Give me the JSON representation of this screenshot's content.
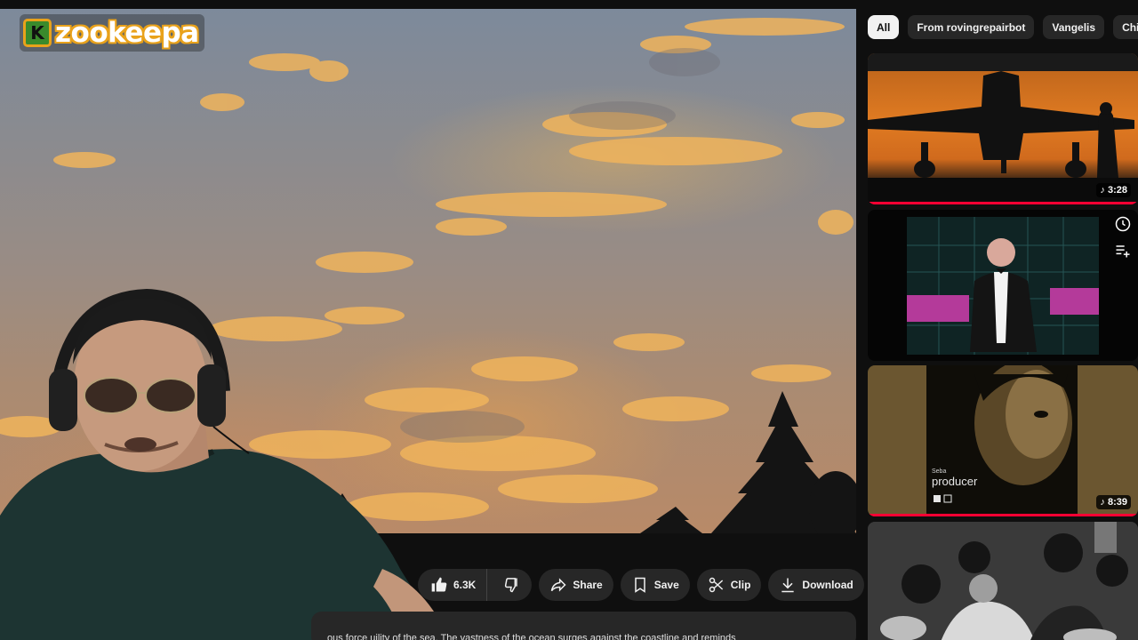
{
  "logo": {
    "icon_letter": "K",
    "text": "zookeepa",
    "icon_name": "kick-logo-icon",
    "accent": "#e9a21b",
    "brand_green": "#3a8a2c"
  },
  "actions": {
    "like_count": "6.3K",
    "share_label": "Share",
    "save_label": "Save",
    "clip_label": "Clip",
    "download_label": "Download",
    "icons": [
      "thumbs-up-icon",
      "thumbs-down-icon",
      "share-icon",
      "save-icon",
      "clip-icon",
      "download-icon",
      "more-icon"
    ]
  },
  "description": {
    "text": "ous force                    uility of the sea. The vastness of the ocean surges against the coastline and reminds"
  },
  "chips": [
    {
      "label": "All",
      "active": true
    },
    {
      "label": "From rovingrepairbot",
      "active": false
    },
    {
      "label": "Vangelis",
      "active": false
    },
    {
      "label": "Chill-out",
      "active": false
    }
  ],
  "recommendations": [
    {
      "duration": "3:28",
      "watched_fraction": 1.0,
      "icon": "music-note-icon"
    },
    {
      "duration": "",
      "watched_fraction": 0,
      "hover_icons": [
        "watch-later-icon",
        "add-to-queue-icon"
      ]
    },
    {
      "duration": "8:39",
      "watched_fraction": 1.0,
      "icon": "music-note-icon",
      "cover_text": {
        "artist": "Seba",
        "title": "producer"
      }
    },
    {
      "duration": "",
      "watched_fraction": 0
    }
  ],
  "colors": {
    "background": "#0f0f0f",
    "surface": "#272727",
    "progress": "#ff0033"
  }
}
